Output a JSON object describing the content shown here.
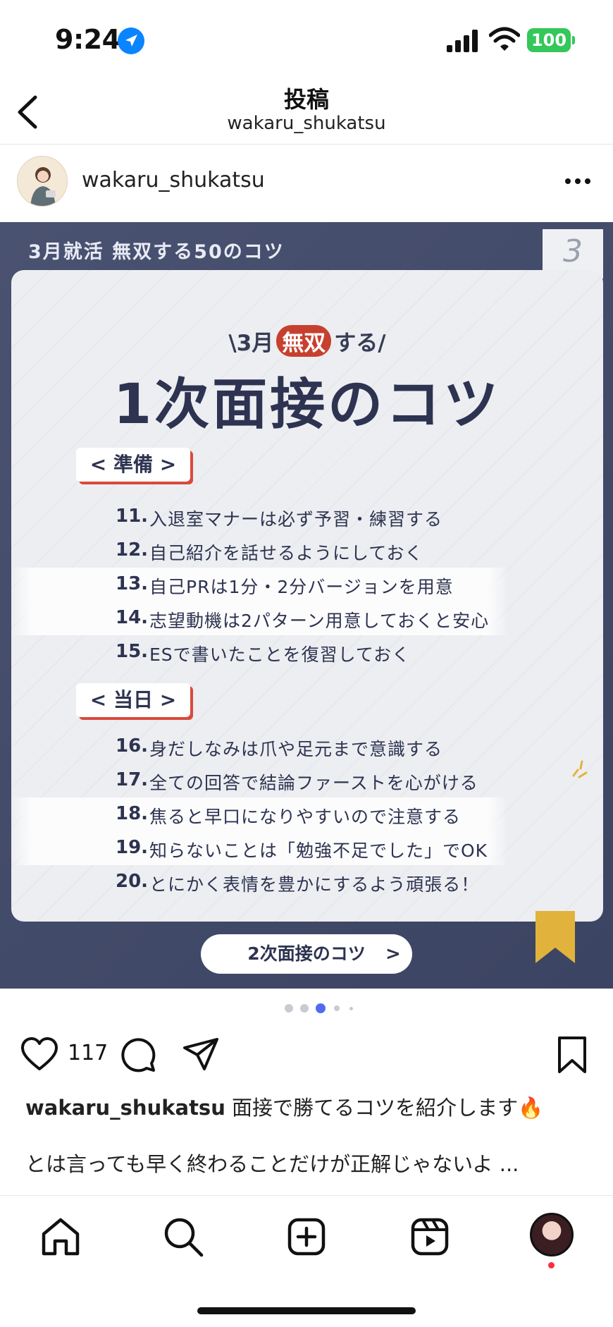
{
  "status_bar": {
    "time": "9:24",
    "battery": "100"
  },
  "header": {
    "title": "投稿",
    "subtitle": "wakaru_shukatsu"
  },
  "post": {
    "username": "wakaru_shukatsu",
    "image": {
      "series_label": "3月就活 無双する50のコツ",
      "page_number": "3",
      "tagline_pre": "\\3月",
      "tagline_highlight": "無双",
      "tagline_post": "する/",
      "title": "1次面接のコツ",
      "section1": "< 準備 >",
      "section1_items": [
        {
          "num": "11.",
          "text": "入退室マナーは必ず予習・練習する"
        },
        {
          "num": "12.",
          "text": "自己紹介を話せるようにしておく"
        },
        {
          "num": "13.",
          "text": "自己PRは1分・2分バージョンを用意"
        },
        {
          "num": "14.",
          "text": "志望動機は2パターン用意しておくと安心"
        },
        {
          "num": "15.",
          "text": "ESで書いたことを復習しておく"
        }
      ],
      "section2": "< 当日 >",
      "section2_items": [
        {
          "num": "16.",
          "text": "身だしなみは爪や足元まで意識する"
        },
        {
          "num": "17.",
          "text": "全ての回答で結論ファーストを心がける"
        },
        {
          "num": "18.",
          "text": "焦ると早口になりやすいので注意する"
        },
        {
          "num": "19.",
          "text": "知らないことは「勉強不足でした」でOK"
        },
        {
          "num": "20.",
          "text": "とにかく表情を豊かにするよう頑張る！"
        }
      ],
      "next_button": "2次面接のコツ",
      "next_arrow": ">"
    },
    "carousel": {
      "total": 5,
      "active_index": 2
    },
    "like_count": "117",
    "caption_user": "wakaru_shukatsu",
    "caption_text": " 面接で勝てるコツを紹介します🔥",
    "caption_line2": "とは言っても早く終わることだけが正解じゃないよ ..."
  },
  "icons": {
    "location": "location-arrow-icon",
    "signal": "cellular-signal-icon",
    "wifi": "wifi-icon",
    "back": "chevron-left-icon",
    "more": "more-horizontal-icon",
    "like": "heart-icon",
    "comment": "comment-icon",
    "share": "send-icon",
    "save": "bookmark-icon"
  },
  "colors": {
    "accent_red": "#c7402f",
    "card_navy": "#3c4463",
    "battery_green": "#34c759",
    "active_dot": "#4f6cf0"
  }
}
